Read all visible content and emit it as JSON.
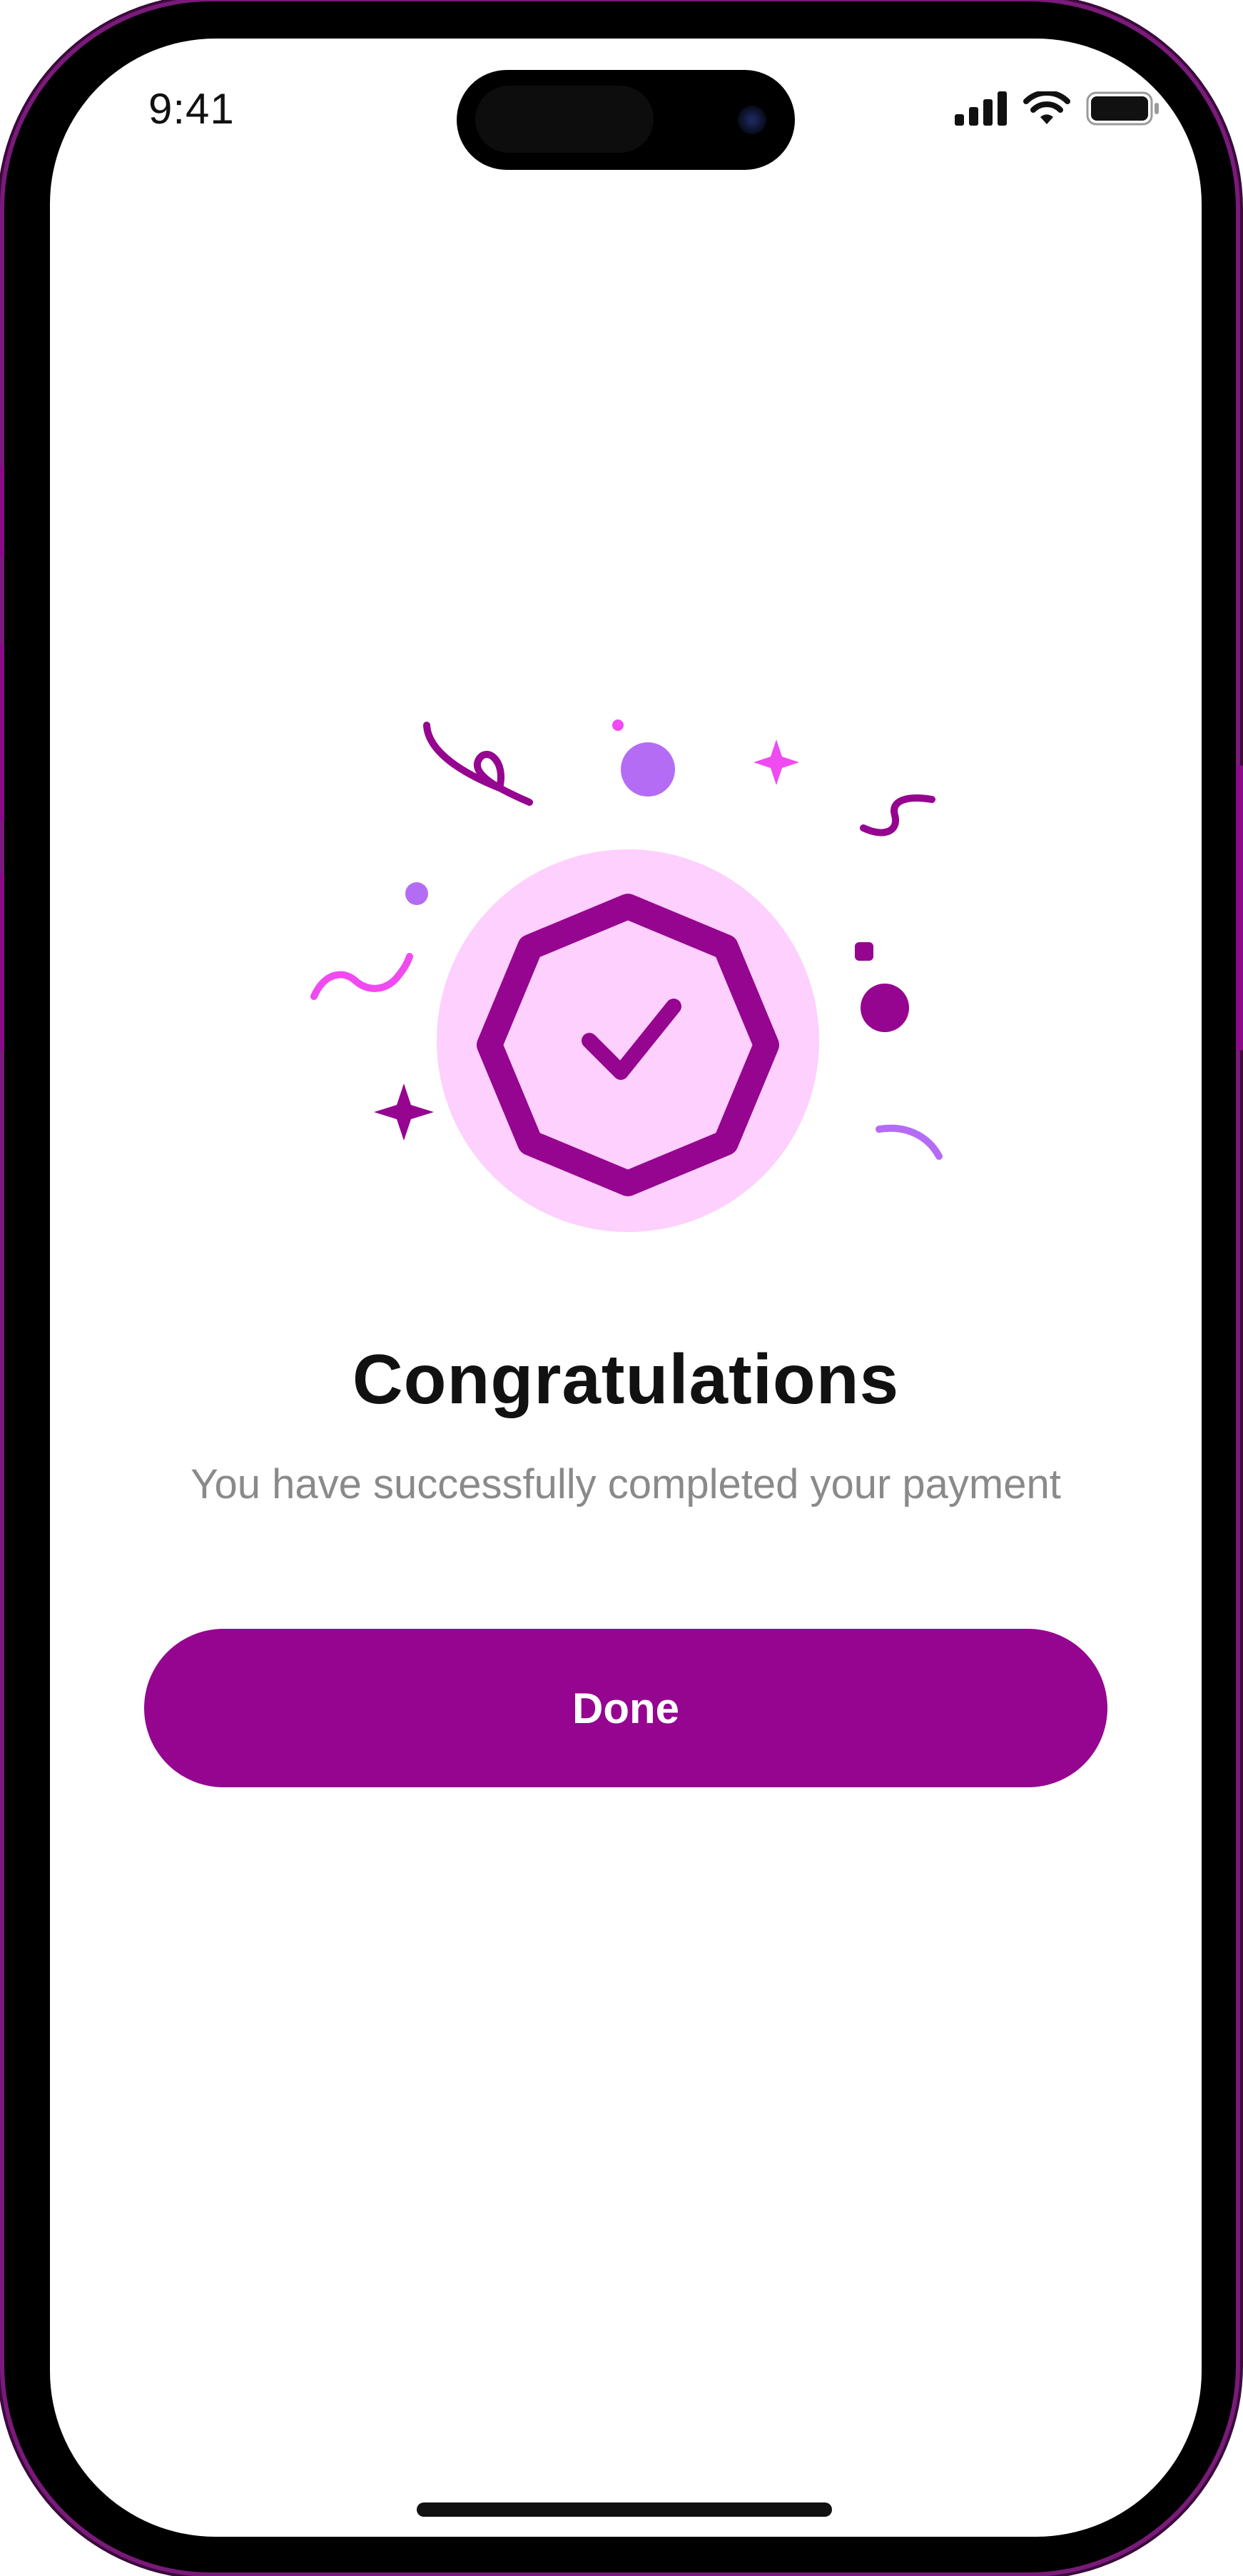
{
  "status_bar": {
    "time": "9:41",
    "icons": [
      "cellular-signal-icon",
      "wifi-icon",
      "battery-icon"
    ]
  },
  "illustration": {
    "icon": "verified-badge-check-icon"
  },
  "content": {
    "title": "Congratulations",
    "subtitle": "You have successfully completed your payment"
  },
  "actions": {
    "done_label": "Done"
  },
  "colors": {
    "primary": "#950590",
    "badge_background": "#FDD0FD",
    "accent_light_purple": "#B56CF5",
    "accent_pink": "#F04BF0",
    "title_text": "#111111",
    "subtitle_text": "#8A8A8A"
  }
}
